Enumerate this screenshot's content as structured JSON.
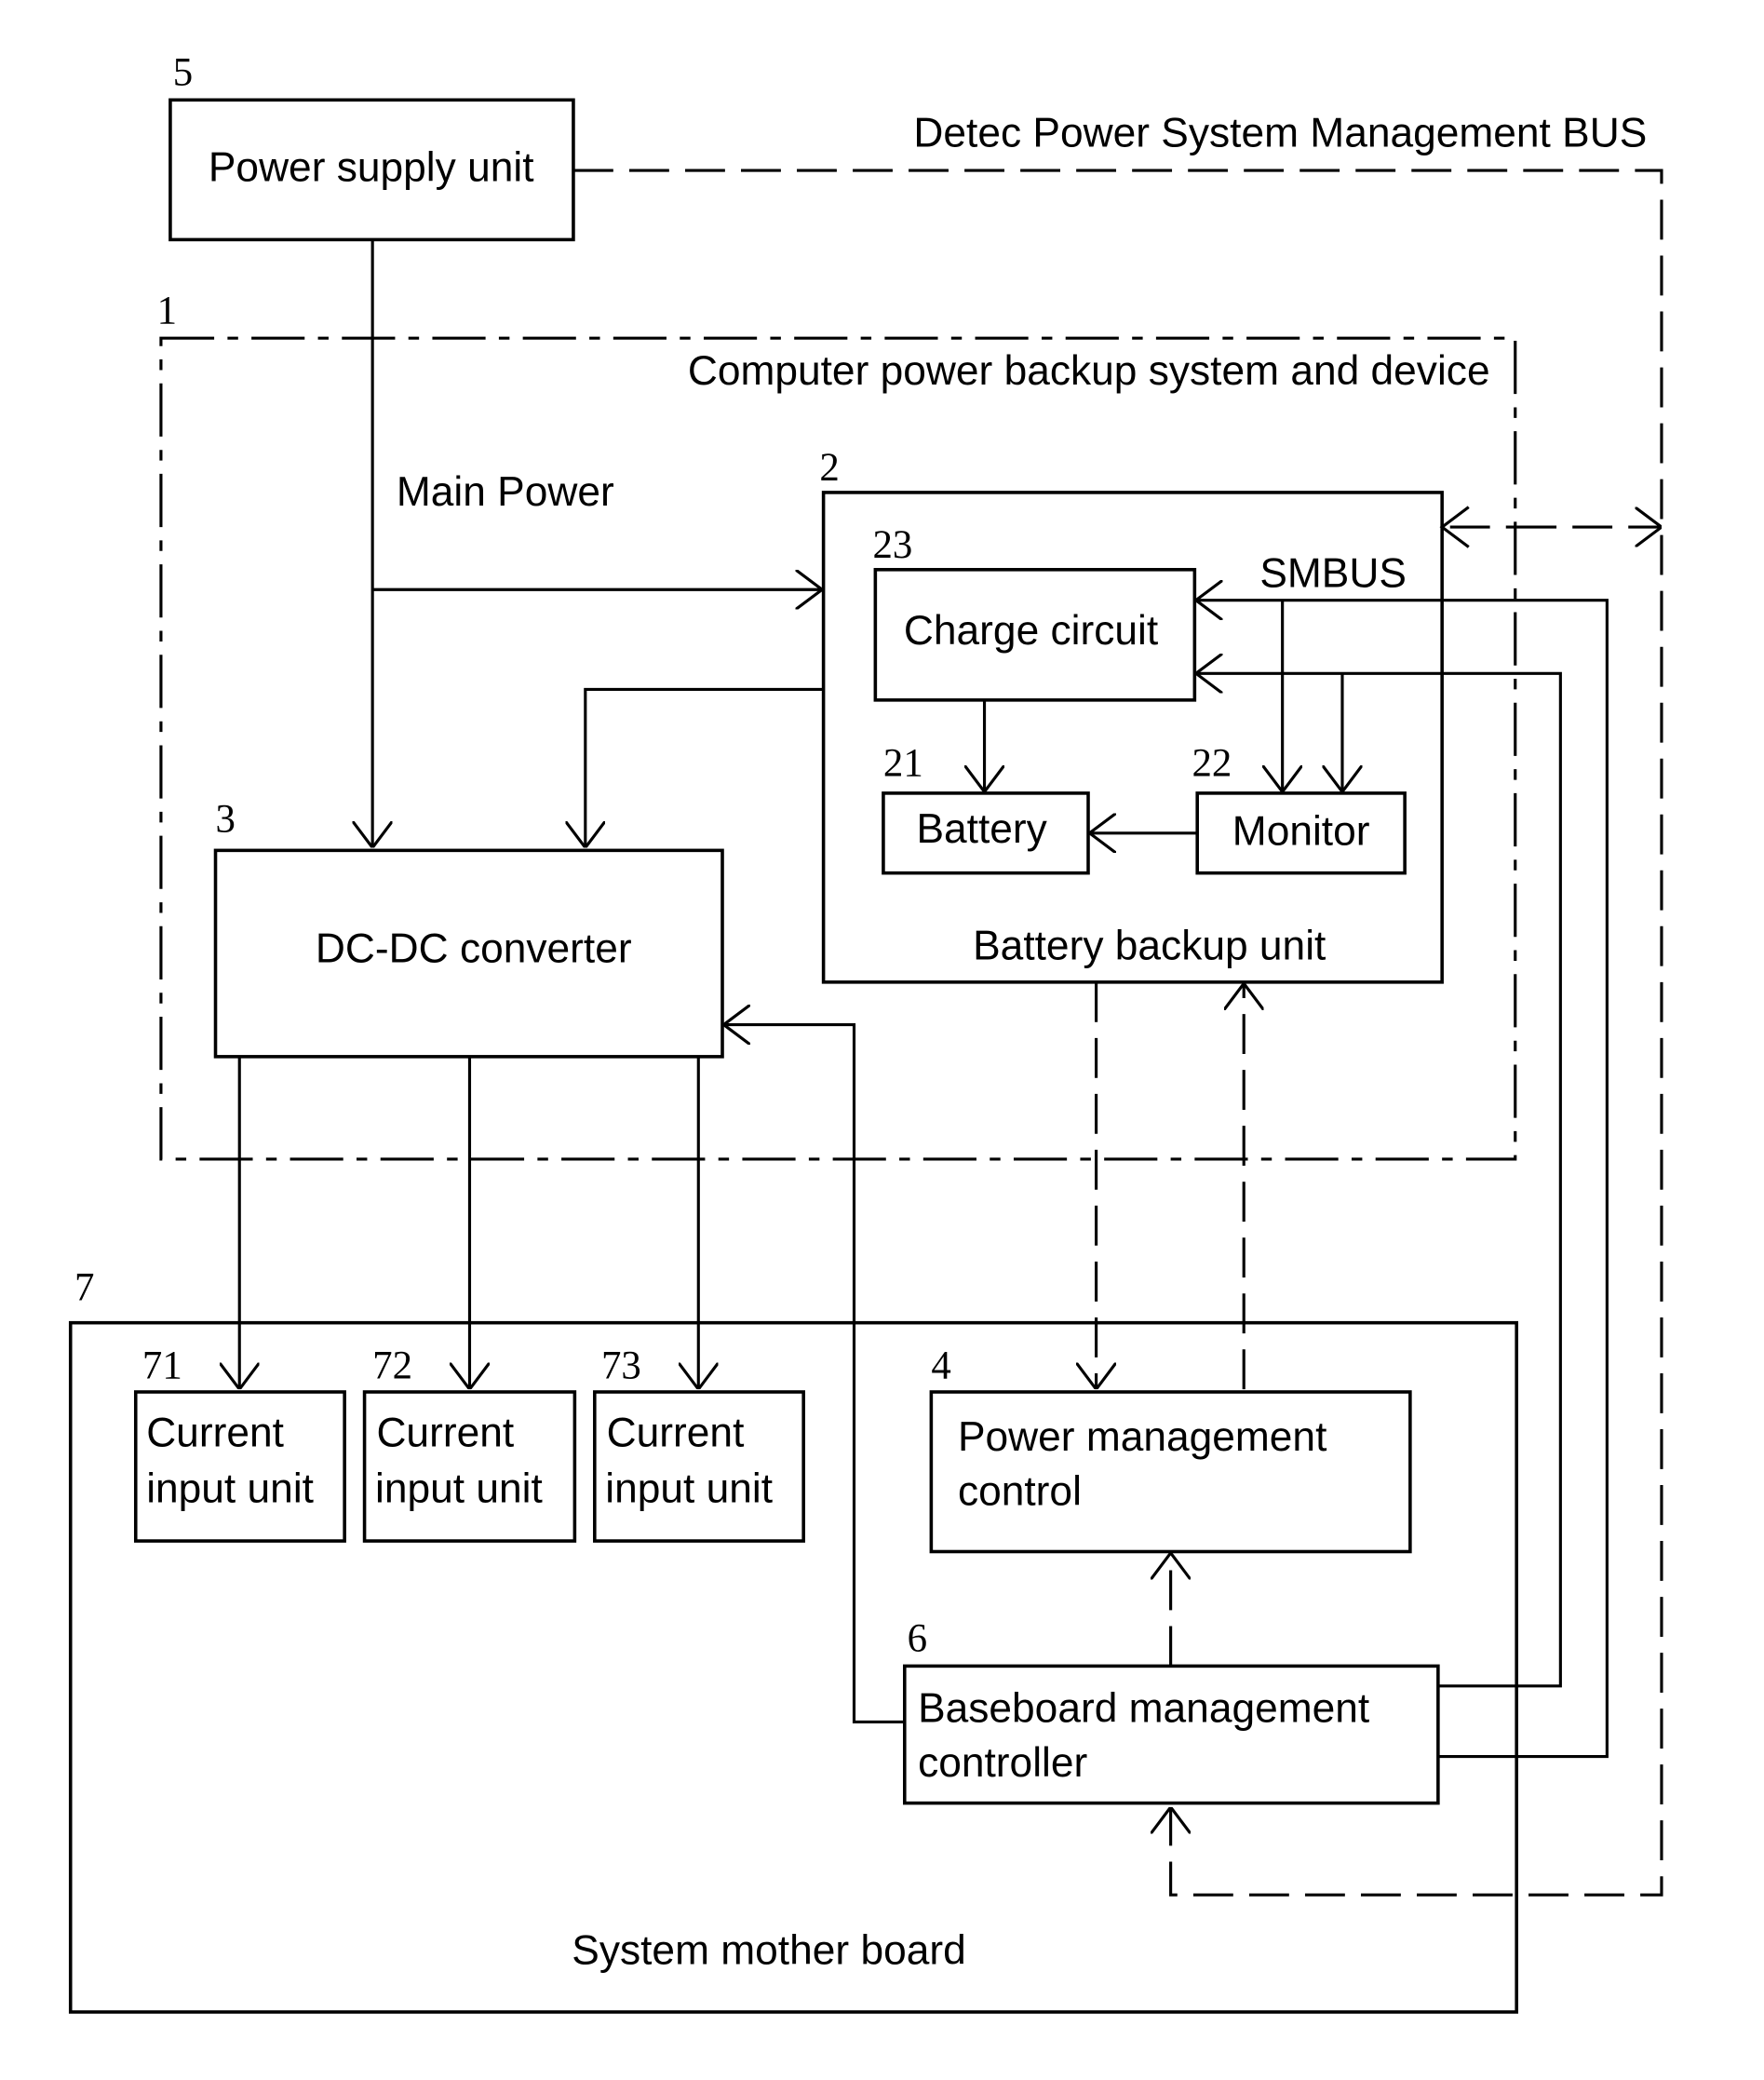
{
  "diagram": {
    "bus_label": "Detec Power System Management BUS",
    "main_power_label": "Main Power",
    "smbus_label": "SMBUS",
    "blocks": {
      "power_supply": {
        "ref": "5",
        "label": "Power supply unit"
      },
      "backup_system": {
        "ref": "1",
        "label": "Computer power backup system and device"
      },
      "battery_backup": {
        "ref": "2",
        "label": "Battery backup unit"
      },
      "charge_circuit": {
        "ref": "23",
        "label": "Charge circuit"
      },
      "battery": {
        "ref": "21",
        "label": "Battery"
      },
      "monitor": {
        "ref": "22",
        "label": "Monitor"
      },
      "dcdc": {
        "ref": "3",
        "label": "DC-DC converter"
      },
      "motherboard": {
        "ref": "7",
        "label": "System mother board"
      },
      "current1": {
        "ref": "71",
        "line1": "Current",
        "line2": "input unit"
      },
      "current2": {
        "ref": "72",
        "line1": "Current",
        "line2": "input unit"
      },
      "current3": {
        "ref": "73",
        "line1": "Current",
        "line2": "input unit"
      },
      "pmc": {
        "ref": "4",
        "line1": "Power management",
        "line2": "control"
      },
      "bmc": {
        "ref": "6",
        "line1": "Baseboard management",
        "line2": "controller"
      }
    }
  }
}
